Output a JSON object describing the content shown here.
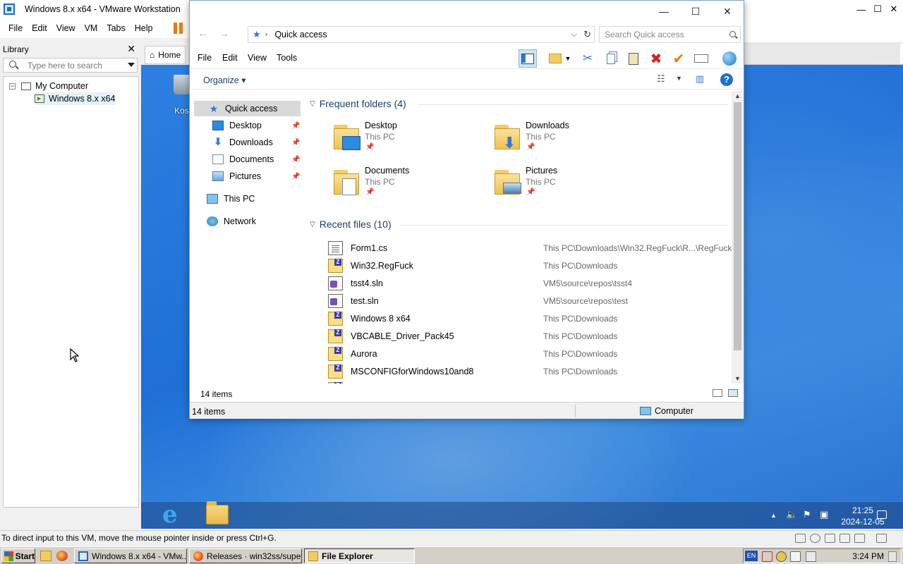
{
  "vmware": {
    "title": "Windows 8.x x64 - VMware Workstation",
    "menu": [
      "File",
      "Edit",
      "View",
      "VM",
      "Tabs",
      "Help"
    ],
    "library": {
      "title": "Library",
      "search_placeholder": "Type here to search",
      "tree": [
        {
          "label": "My Computer",
          "expand": "−"
        },
        {
          "label": "Windows 8.x x64"
        }
      ]
    },
    "tab_home": "Home",
    "status_message": "To direct input to this VM, move the mouse pointer inside or press Ctrl+G."
  },
  "guest": {
    "recycle_label": "Kosz",
    "clock_time": "21:25",
    "clock_date": "2024-12-05"
  },
  "explorer": {
    "address": "Quick access",
    "search_placeholder": "Search Quick access",
    "menu": [
      "File",
      "Edit",
      "View",
      "Tools"
    ],
    "organize": "Organize",
    "nav": [
      {
        "label": "Quick access"
      },
      {
        "label": "Desktop"
      },
      {
        "label": "Downloads"
      },
      {
        "label": "Documents"
      },
      {
        "label": "Pictures"
      },
      {
        "label": "This PC"
      },
      {
        "label": "Network"
      }
    ],
    "frequent_header": "Frequent folders (4)",
    "frequent": [
      {
        "name": "Desktop",
        "loc": "This PC"
      },
      {
        "name": "Downloads",
        "loc": "This PC"
      },
      {
        "name": "Documents",
        "loc": "This PC"
      },
      {
        "name": "Pictures",
        "loc": "This PC"
      }
    ],
    "recent_header": "Recent files (10)",
    "recent": [
      {
        "name": "Form1.cs",
        "loc": "This PC\\Downloads\\Win32.RegFuck\\R...\\RegFuck",
        "icon": "cs"
      },
      {
        "name": "Win32.RegFuck",
        "loc": "This PC\\Downloads",
        "icon": "zip"
      },
      {
        "name": "tsst4.sln",
        "loc": "VM5\\source\\repos\\tsst4",
        "icon": "sln"
      },
      {
        "name": "test.sln",
        "loc": "VM5\\source\\repos\\test",
        "icon": "sln"
      },
      {
        "name": "Windows 8 x64",
        "loc": "This PC\\Downloads",
        "icon": "zip"
      },
      {
        "name": "VBCABLE_Driver_Pack45",
        "loc": "This PC\\Downloads",
        "icon": "zip"
      },
      {
        "name": "Aurora",
        "loc": "This PC\\Downloads",
        "icon": "zip"
      },
      {
        "name": "MSCONFIGforWindows10and8",
        "loc": "This PC\\Downloads",
        "icon": "zip"
      }
    ],
    "item_count": "14 items",
    "status_count": "14 items",
    "status_location": "Computer"
  },
  "host_taskbar": {
    "start": "Start",
    "tasks": [
      {
        "label": "Windows 8.x x64 - VMw..."
      },
      {
        "label": "Releases · win32ss/supe..."
      },
      {
        "label": "File Explorer"
      }
    ],
    "lang": "EN",
    "clock": "3:24 PM"
  },
  "colors": {
    "accent": "#2f7bd4",
    "vm_pause": "#f07800",
    "desktop": "#2d7fe0",
    "close_red": "#d81e1e",
    "check_orange": "#f07800"
  }
}
